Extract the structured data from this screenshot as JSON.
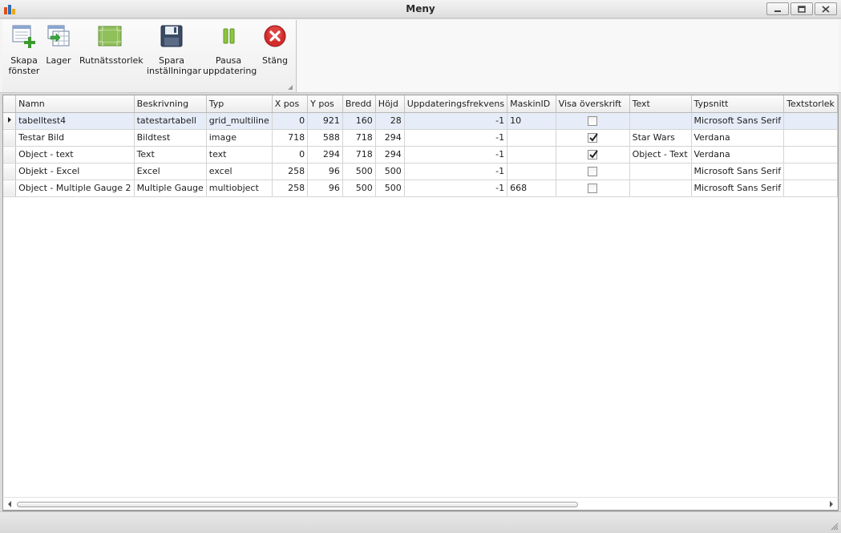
{
  "window": {
    "title": "Meny"
  },
  "toolbar": {
    "buttons": [
      {
        "label": "Skapa\nfönster",
        "icon": "create-window-icon"
      },
      {
        "label": "Lager",
        "icon": "layer-icon"
      },
      {
        "label": "Rutnätsstorlek",
        "icon": "grid-size-icon"
      },
      {
        "label": "Spara\ninställningar",
        "icon": "save-icon"
      },
      {
        "label": "Pausa\nuppdatering",
        "icon": "pause-icon"
      },
      {
        "label": "Stäng",
        "icon": "close-circle-icon"
      }
    ]
  },
  "grid": {
    "columns": [
      "Namn",
      "Beskrivning",
      "Typ",
      "X pos",
      "Y pos",
      "Bredd",
      "Höjd",
      "Uppdateringsfrekvens",
      "MaskinID",
      "Visa överskrift",
      "Text",
      "Typsnitt",
      "Textstorlek"
    ],
    "rows": [
      {
        "namn": "tabelltest4",
        "beskrivning": "tatestartabell",
        "typ": "grid_multiline",
        "xpos": "0",
        "ypos": "921",
        "bredd": "160",
        "hojd": "28",
        "frekvens": "-1",
        "maskinid": "10",
        "visa": false,
        "text": "",
        "typsnitt": "Microsoft Sans Serif"
      },
      {
        "namn": "Testar Bild",
        "beskrivning": "Bildtest",
        "typ": "image",
        "xpos": "718",
        "ypos": "588",
        "bredd": "718",
        "hojd": "294",
        "frekvens": "-1",
        "maskinid": "",
        "visa": true,
        "text": "Star Wars",
        "typsnitt": "Verdana"
      },
      {
        "namn": "Object - text",
        "beskrivning": "Text",
        "typ": "text",
        "xpos": "0",
        "ypos": "294",
        "bredd": "718",
        "hojd": "294",
        "frekvens": "-1",
        "maskinid": "",
        "visa": true,
        "text": "Object - Text",
        "typsnitt": "Verdana"
      },
      {
        "namn": "Objekt - Excel",
        "beskrivning": "Excel",
        "typ": "excel",
        "xpos": "258",
        "ypos": "96",
        "bredd": "500",
        "hojd": "500",
        "frekvens": "-1",
        "maskinid": "",
        "visa": false,
        "text": "",
        "typsnitt": "Microsoft Sans Serif"
      },
      {
        "namn": "Object - Multiple Gauge 2",
        "beskrivning": "Multiple Gauge",
        "typ": "multiobject",
        "xpos": "258",
        "ypos": "96",
        "bredd": "500",
        "hojd": "500",
        "frekvens": "-1",
        "maskinid": "668",
        "visa": false,
        "text": "",
        "typsnitt": "Microsoft Sans Serif"
      }
    ],
    "selected_row": 0
  }
}
